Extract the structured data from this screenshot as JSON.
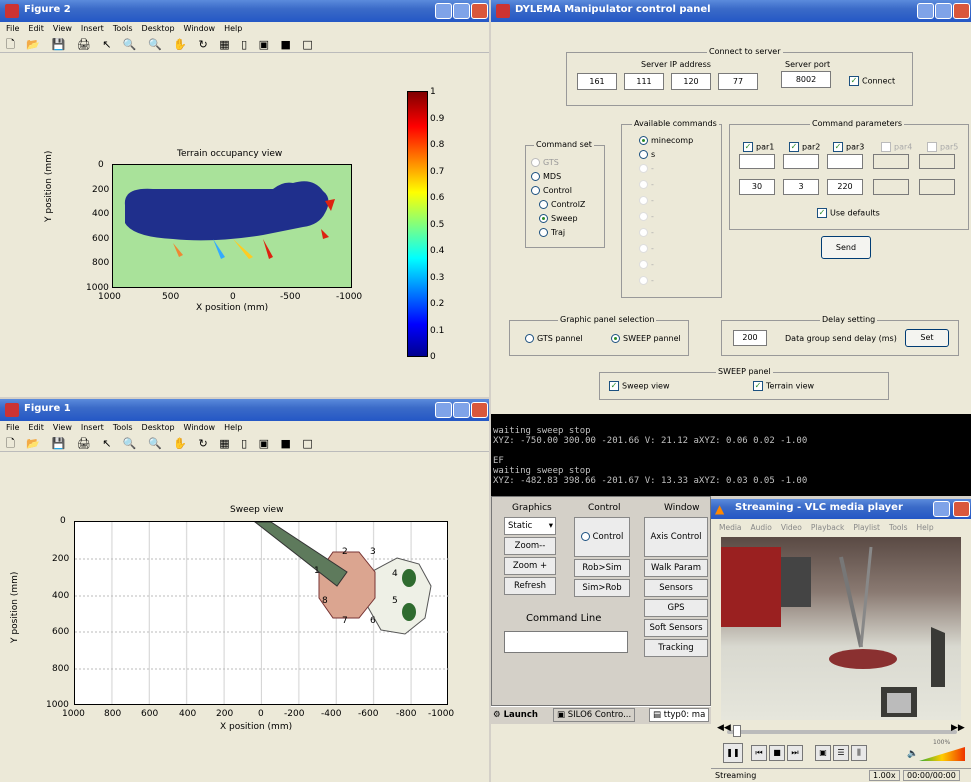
{
  "fig2": {
    "title": "Figure 2",
    "menu": [
      "File",
      "Edit",
      "View",
      "Insert",
      "Tools",
      "Desktop",
      "Window",
      "Help"
    ],
    "toolbar": "🗋 📂 💾 🖨 ↖ 🔍 🔍 ✋ ↻ ▦ ▯ ▣ ■ □",
    "plot_title": "Terrain occupancy view",
    "xlabel": "X position (mm)",
    "ylabel": "Y position (mm)",
    "xticks": [
      "1000",
      "500",
      "0",
      "-500",
      "-1000"
    ],
    "yticks": [
      "0",
      "200",
      "400",
      "600",
      "800",
      "1000"
    ],
    "colorbar_ticks": [
      "1",
      "0.9",
      "0.8",
      "0.7",
      "0.6",
      "0.5",
      "0.4",
      "0.3",
      "0.2",
      "0.1",
      "0"
    ]
  },
  "fig1": {
    "title": "Figure 1",
    "menu": [
      "File",
      "Edit",
      "View",
      "Insert",
      "Tools",
      "Desktop",
      "Window",
      "Help"
    ],
    "toolbar": "🗋 📂 💾 🖨 ↖ 🔍 🔍 ✋ ↻ ▦ ▯ ▣ ■ □",
    "plot_title": "Sweep view",
    "xlabel": "X position (mm)",
    "ylabel": "Y position (mm)",
    "xticks": [
      "1000",
      "800",
      "600",
      "400",
      "200",
      "0",
      "-200",
      "-400",
      "-600",
      "-800",
      "-1000"
    ],
    "yticks": [
      "0",
      "200",
      "400",
      "600",
      "800",
      "1000"
    ],
    "leg_labels": [
      "1",
      "2",
      "3",
      "4",
      "5",
      "6",
      "7",
      "8"
    ]
  },
  "panel": {
    "title": "DYLEMA Manipulator control panel",
    "connect_title": "Connect to server",
    "ip_label": "Server IP address",
    "port_label": "Server port",
    "ip": [
      "161",
      "111",
      "120",
      "77"
    ],
    "port": "8002",
    "connect_label": "Connect",
    "cmdset_title": "Command set",
    "cmdset": [
      "GTS",
      "MDS",
      "Control",
      "ControlZ",
      "Sweep",
      "Traj"
    ],
    "avail_title": "Available commands",
    "avail": [
      "minecomp",
      "s",
      "-",
      "-",
      "-",
      "-",
      "-",
      "-",
      "-",
      "-",
      "-"
    ],
    "params_title": "Command parameters",
    "params": [
      "par1",
      "par2",
      "par3",
      "par4",
      "par5"
    ],
    "param_values": [
      "30",
      "3",
      "220",
      "",
      ""
    ],
    "use_defaults": "Use defaults",
    "send": "Send",
    "graphic_title": "Graphic panel selection",
    "gts_pannel": "GTS pannel",
    "sweep_pannel": "SWEEP pannel",
    "delay_title": "Delay setting",
    "delay_value": "200",
    "delay_label": "Data group send delay (ms)",
    "set": "Set",
    "sweep_panel_title": "SWEEP panel",
    "sweep_view": "Sweep view",
    "terrain_view": "Terrain view"
  },
  "terminal": [
    "waiting sweep stop",
    "XYZ: -750.00 300.00 -201.66 V: 21.12 aXYZ: 0.06 0.02 -1.00",
    "",
    "EF",
    "waiting sweep stop",
    "XYZ: -482.83 398.66 -201.67 V: 13.33 aXYZ: 0.03 0.05 -1.00"
  ],
  "gui": {
    "graphics": "Graphics",
    "static": "Static",
    "zoom_minus": "Zoom--",
    "zoom_plus": "Zoom +",
    "refresh": "Refresh",
    "control_hdr": "Control",
    "control_radio": "Control",
    "rob_sim": "Rob>Sim",
    "sim_rob": "Sim>Rob",
    "window_hdr": "Window",
    "axis_control": "Axis Control",
    "walk_param": "Walk Param",
    "sensors": "Sensors",
    "gps": "GPS",
    "soft_sensors": "Soft Sensors",
    "tracking": "Tracking",
    "command_line": "Command Line"
  },
  "taskbar": {
    "launch": "Launch",
    "task1": "SILO6 Contro...",
    "task2": "ttyp0: ma"
  },
  "vlc": {
    "title": "Streaming - VLC media player",
    "menu": [
      "Media",
      "Audio",
      "Video",
      "Playback",
      "Playlist",
      "Tools",
      "Help"
    ],
    "status": "Streaming",
    "speed": "1.00x",
    "time": "00:00/00:00",
    "volume": "100%"
  },
  "colors": {
    "colormap_low": "#00008f",
    "colormap_high": "#800000",
    "fill_green": "#a9e29a",
    "body_blue": "#1f2f8c"
  }
}
